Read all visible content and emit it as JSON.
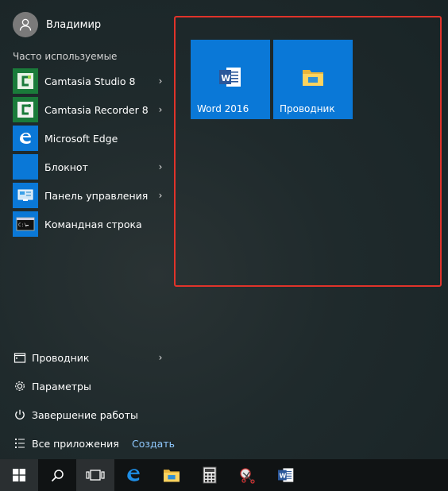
{
  "user": {
    "name": "Владимир"
  },
  "most_used": {
    "title": "Часто используемые",
    "apps": [
      {
        "label": "Camtasia Studio 8",
        "icon": "camtasia-studio-icon",
        "has_submenu": true
      },
      {
        "label": "Camtasia Recorder 8",
        "icon": "camtasia-recorder-icon",
        "has_submenu": true
      },
      {
        "label": "Microsoft Edge",
        "icon": "edge-icon",
        "has_submenu": false
      },
      {
        "label": "Блокнот",
        "icon": "notepad-icon",
        "has_submenu": true
      },
      {
        "label": "Панель управления",
        "icon": "control-panel-icon",
        "has_submenu": true
      },
      {
        "label": "Командная строка",
        "icon": "command-prompt-icon",
        "has_submenu": false
      }
    ]
  },
  "bottom": {
    "explorer": "Проводник",
    "settings": "Параметры",
    "shutdown": "Завершение работы",
    "all_apps": "Все приложения",
    "create": "Создать"
  },
  "tiles": [
    {
      "label": "Word 2016",
      "icon": "word-icon"
    },
    {
      "label": "Проводник",
      "icon": "file-explorer-icon"
    }
  ],
  "taskbar": {
    "items": [
      "windows-start-icon",
      "search-icon",
      "task-view-icon",
      "edge-icon",
      "file-explorer-icon",
      "calculator-icon",
      "snipping-tool-icon",
      "word-icon"
    ]
  },
  "colors": {
    "tile_blue": "#0a78d7",
    "highlight_border": "#e0332a",
    "camtasia_green": "#1a7b3a",
    "link_blue": "#8fc8ff"
  }
}
